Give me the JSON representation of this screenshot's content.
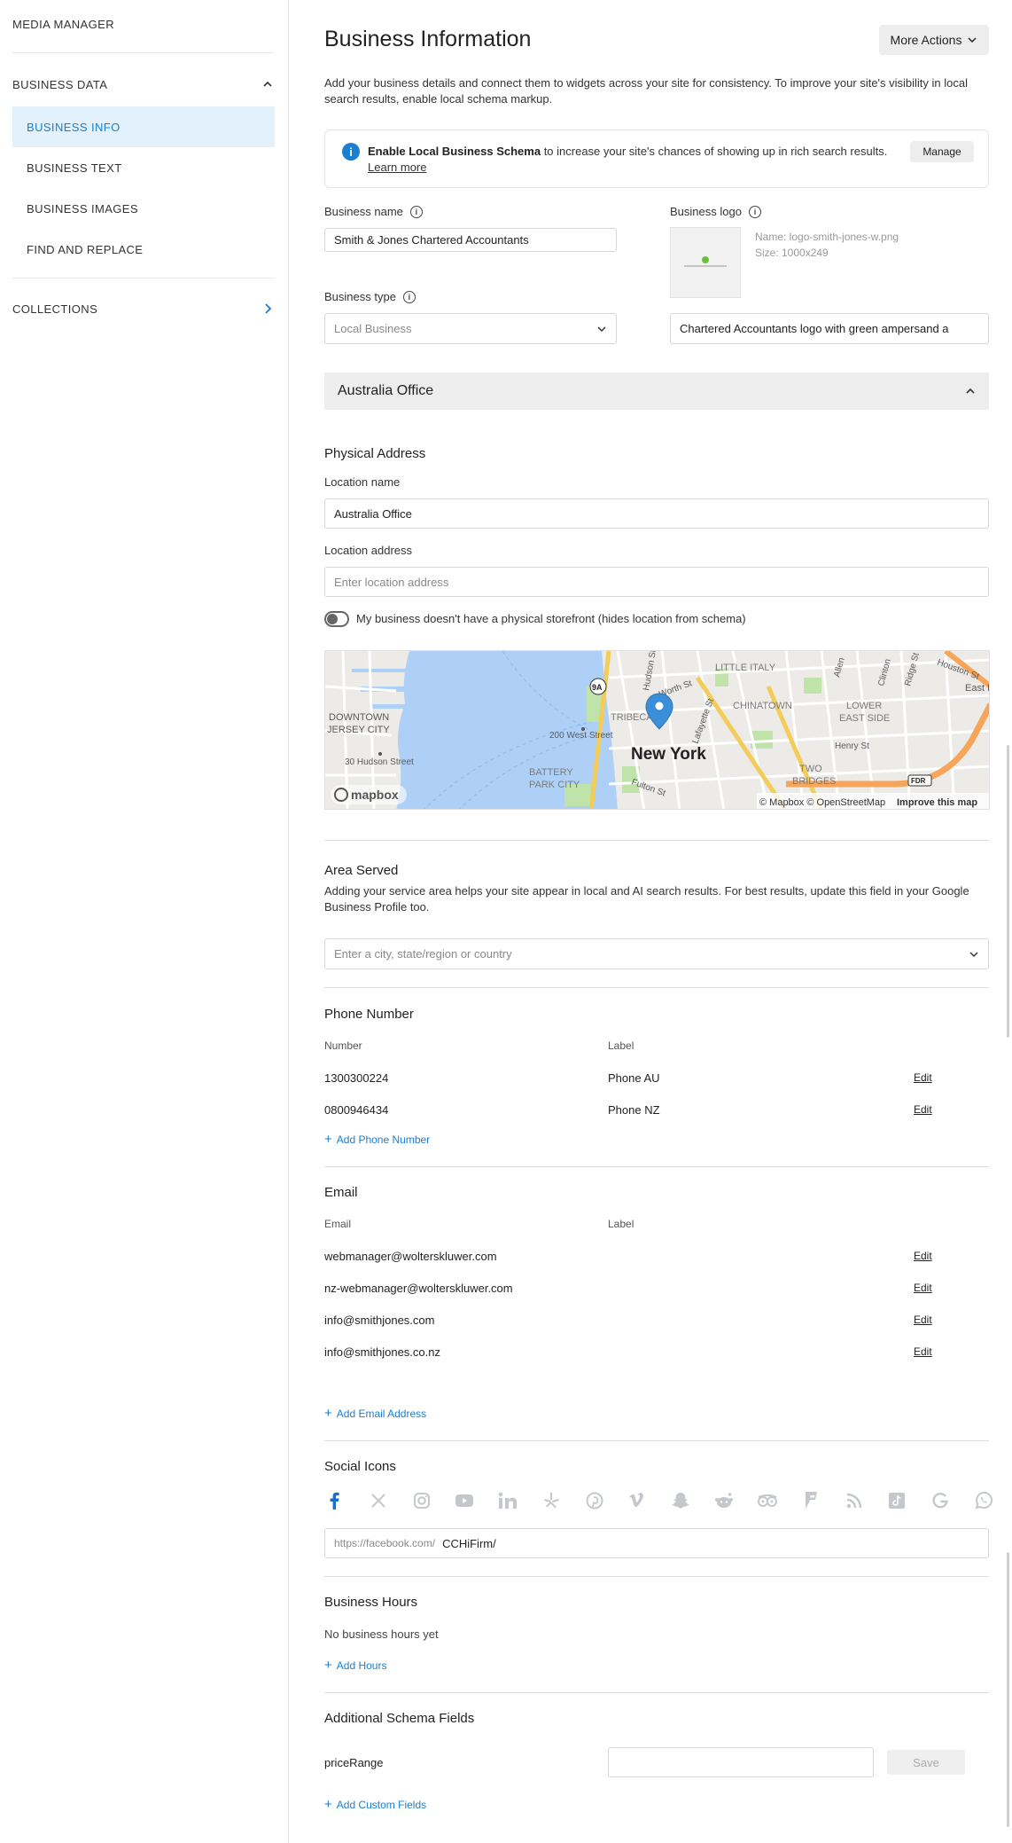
{
  "sidebar": {
    "media_manager": "MEDIA MANAGER",
    "business_data": "BUSINESS DATA",
    "items": [
      "BUSINESS INFO",
      "BUSINESS TEXT",
      "BUSINESS IMAGES",
      "FIND AND REPLACE"
    ],
    "active_item": "BUSINESS INFO",
    "collections": "COLLECTIONS"
  },
  "header": {
    "title": "Business Information",
    "more_actions": "More Actions",
    "intro": "Add your business details and connect them to widgets across your site for consistency. To improve your site's visibility in local search results, enable local schema markup."
  },
  "schema_banner": {
    "bold": "Enable Local Business Schema",
    "text": " to increase your site's chances of showing up in rich search results.",
    "learn_more": "Learn more",
    "manage": "Manage"
  },
  "business": {
    "name_label": "Business name",
    "name_value": "Smith & Jones Chartered Accountants",
    "type_label": "Business type",
    "type_placeholder": "Local Business",
    "logo_label": "Business logo",
    "logo_name": "Name: logo-smith-jones-w.png",
    "logo_size": "Size: 1000x249",
    "logo_alt": "Chartered Accountants logo with green ampersand a"
  },
  "location": {
    "office_title": "Australia Office",
    "physical_address": "Physical Address",
    "location_name_label": "Location name",
    "location_name_value": "Australia Office",
    "location_address_label": "Location address",
    "location_address_placeholder": "Enter location address",
    "toggle_label": "My business doesn't have a physical storefront (hides location from schema)"
  },
  "map": {
    "labels": {
      "new_york": "New York",
      "downtown": "DOWNTOWN",
      "jersey_city": "JERSEY CITY",
      "hudson_st_30": "30 Hudson Street",
      "west_st_200": "200 West Street",
      "battery": "BATTERY",
      "park_city": "PARK CITY",
      "tribeca": "TRIBECA",
      "chinatown": "CHINATOWN",
      "little_italy": "LITTLE ITALY",
      "lower": "LOWER",
      "east_side": "EAST SIDE",
      "two": "TWO",
      "bridges": "BRIDGES",
      "henry_st": "Henry St",
      "fulton_st": "Fulton St",
      "worth_st": "Worth St",
      "lafayette_st": "Lafayette St",
      "hudson_st": "Hudson St",
      "allen": "Allen",
      "clinton": "Clinton",
      "ridge_st": "Ridge St",
      "houston_st": "Houston St",
      "east_r": "East R",
      "route_9a": "9A",
      "fdr": "FDR"
    },
    "logo": "mapbox",
    "attribution": "© Mapbox © OpenStreetMap",
    "improve": "Improve this map",
    "colors": {
      "water": "#aed0f7",
      "land": "#ecebe8",
      "park": "#bfe3a8",
      "highway": "#f6a55a",
      "arterial": "#f3cc5a"
    }
  },
  "area_served": {
    "title": "Area Served",
    "hint": "Adding your service area helps your site appear in local and AI search results. For best results, update this field in your Google Business Profile too.",
    "placeholder": "Enter a city, state/region or country"
  },
  "phone": {
    "title": "Phone Number",
    "col_number": "Number",
    "col_label": "Label",
    "rows": [
      {
        "number": "1300300224",
        "label": "Phone AU",
        "edit": "Edit"
      },
      {
        "number": "0800946434",
        "label": "Phone NZ",
        "edit": "Edit"
      }
    ],
    "add": "Add Phone Number"
  },
  "email": {
    "title": "Email",
    "col_email": "Email",
    "col_label": "Label",
    "rows": [
      {
        "email": "webmanager@wolterskluwer.com",
        "edit": "Edit"
      },
      {
        "email": "nz-webmanager@wolterskluwer.com",
        "edit": "Edit"
      },
      {
        "email": "info@smithjones.com",
        "edit": "Edit"
      },
      {
        "email": "info@smithjones.co.nz",
        "edit": "Edit"
      }
    ],
    "add": "Add Email Address"
  },
  "social": {
    "title": "Social Icons",
    "icons": [
      "facebook-icon",
      "x-icon",
      "instagram-icon",
      "youtube-icon",
      "linkedin-icon",
      "yelp-icon",
      "pinterest-icon",
      "vimeo-icon",
      "snapchat-icon",
      "reddit-icon",
      "tripadvisor-icon",
      "foursquare-icon",
      "rss-icon",
      "tiktok-icon",
      "google-icon",
      "whatsapp-icon"
    ],
    "active_color": "#1b6ec2",
    "inactive_color": "#c4c8cc",
    "url_prefix": "https://facebook.com/",
    "url_value": "CCHiFirm/"
  },
  "hours": {
    "title": "Business Hours",
    "empty": "No business hours yet",
    "add": "Add Hours"
  },
  "schema_fields": {
    "title": "Additional Schema Fields",
    "field_name": "priceRange",
    "field_value": "",
    "save": "Save",
    "add": "Add Custom Fields"
  }
}
